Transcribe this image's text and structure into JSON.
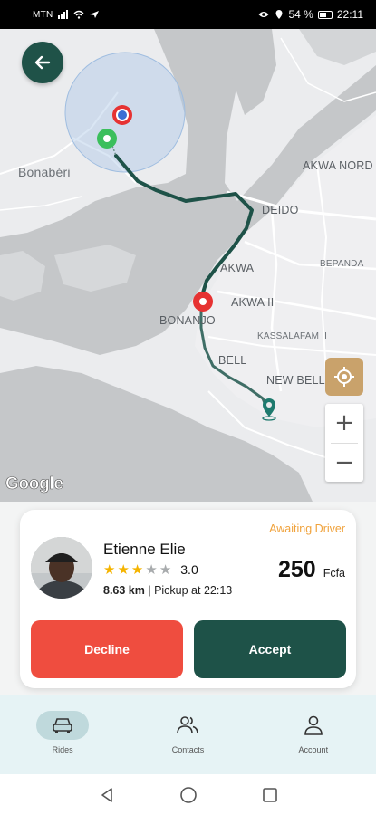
{
  "status_bar": {
    "carrier": "MTN",
    "battery": "54 %",
    "time": "22:11"
  },
  "map": {
    "labels": {
      "bonaberi": "Bonabéri",
      "akwa_nord": "AKWA NORD",
      "deido": "DEIDO",
      "akwa": "AKWA",
      "bepanda": "BEPANDA",
      "akwa_ii": "AKWA II",
      "bonanjo": "BONANJO",
      "kassalafam": "KASSALAFAM II",
      "bell": "BELL",
      "new_bell": "NEW BELL"
    },
    "attribution": "Google",
    "zoom_in": "+",
    "zoom_out": "−",
    "route_color": "#1e5248"
  },
  "ride_card": {
    "status": "Awaiting Driver",
    "driver_name": "Etienne Elie",
    "rating": "3.0",
    "stars_filled": 3,
    "stars_total": 5,
    "distance": "8.63 km",
    "pickup": " | Pickup at 22:13",
    "price": "250",
    "currency": "Fcfa",
    "decline_label": "Decline",
    "accept_label": "Accept",
    "colors": {
      "decline": "#ef4d3f",
      "accept": "#1e5248",
      "status": "#f0a23b",
      "star": "#f5b400"
    }
  },
  "bottom_nav": {
    "items": [
      {
        "label": "Rides",
        "icon": "car-icon",
        "active": true
      },
      {
        "label": "Contacts",
        "icon": "contacts-icon",
        "active": false
      },
      {
        "label": "Account",
        "icon": "person-icon",
        "active": false
      }
    ]
  }
}
